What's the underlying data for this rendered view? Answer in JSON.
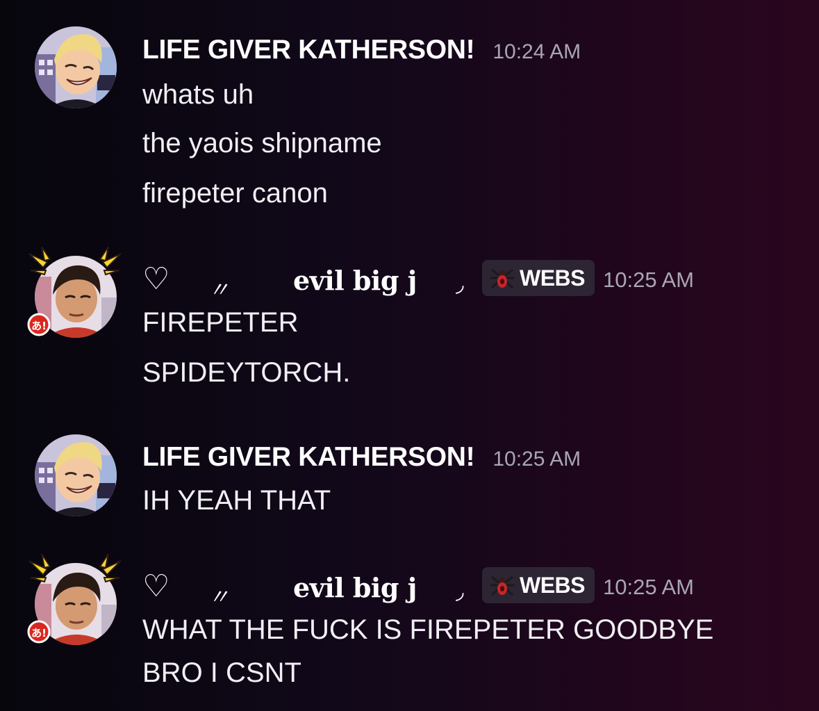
{
  "messages": [
    {
      "username": "LIFE GIVER KATHERSON!",
      "time": "10:24 AM",
      "lines": [
        "whats uh",
        "the yaois shipname",
        "firepeter canon"
      ]
    },
    {
      "heart": "♡",
      "quote_open": "〃",
      "username": "evil big j",
      "quote_close": "◞",
      "badge_icon": "spider-icon",
      "badge": "WEBS",
      "time": "10:25 AM",
      "avatar_sticker": "あ!",
      "lines": [
        "FIREPETER",
        "SPIDEYTORCH."
      ]
    },
    {
      "username": "LIFE GIVER KATHERSON!",
      "time": "10:25 AM",
      "lines": [
        "IH YEAH THAT"
      ]
    },
    {
      "heart": "♡",
      "quote_open": "〃",
      "username": "evil big j",
      "quote_close": "◞",
      "badge_icon": "spider-icon",
      "badge": "WEBS",
      "time": "10:25 AM",
      "avatar_sticker": "あ!",
      "lines": [
        "WHAT THE FUCK IS FIREPETER GOODBYE",
        "BRO I CSNT"
      ]
    }
  ],
  "colors": {
    "background_left": "#07060d",
    "background_right": "#2a051e",
    "timestamp": "#a9a6b3",
    "badge_bg": "#2d2533",
    "sticker_red": "#d9281f"
  }
}
